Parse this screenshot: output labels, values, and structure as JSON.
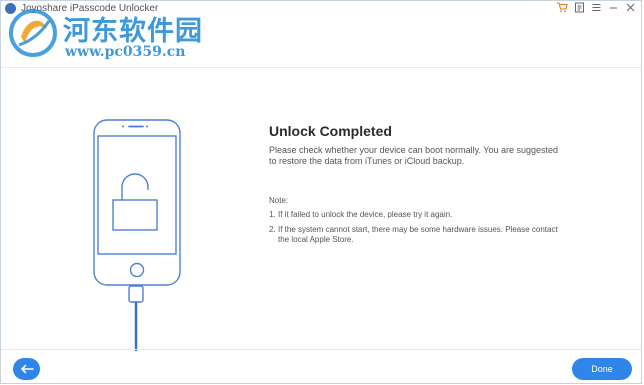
{
  "window": {
    "title": "Joyoshare iPasscode Unlocker",
    "controls": {
      "cart_icon": "cart-icon",
      "register_icon": "register-icon",
      "menu_icon": "menu-icon",
      "minimize_icon": "minimize-icon",
      "close_icon": "close-icon"
    }
  },
  "watermark": {
    "site_name": "河东软件园",
    "url": "www.pc0359.cn"
  },
  "illustration": {
    "device_icon": "iphone-icon",
    "lock_icon": "unlocked-padlock-icon",
    "cable_icon": "usb-cable-icon"
  },
  "content": {
    "title": "Unlock Completed",
    "description": "Please check whether your device can boot normally. You are suggested to restore the data from iTunes or iCloud backup.",
    "note_heading": "Note:",
    "notes": [
      {
        "num": "1.",
        "text": "If it failed to unlock the device, please try it again."
      },
      {
        "num": "2.",
        "text": "If the system cannot start, there may be some hardware issues. Please contact the local Apple Store."
      }
    ]
  },
  "footer": {
    "back_icon": "arrow-left-icon",
    "done_label": "Done"
  },
  "colors": {
    "accent": "#2f86e8",
    "illustration": "#4e7fd9",
    "watermark": "#2a8fd6"
  }
}
